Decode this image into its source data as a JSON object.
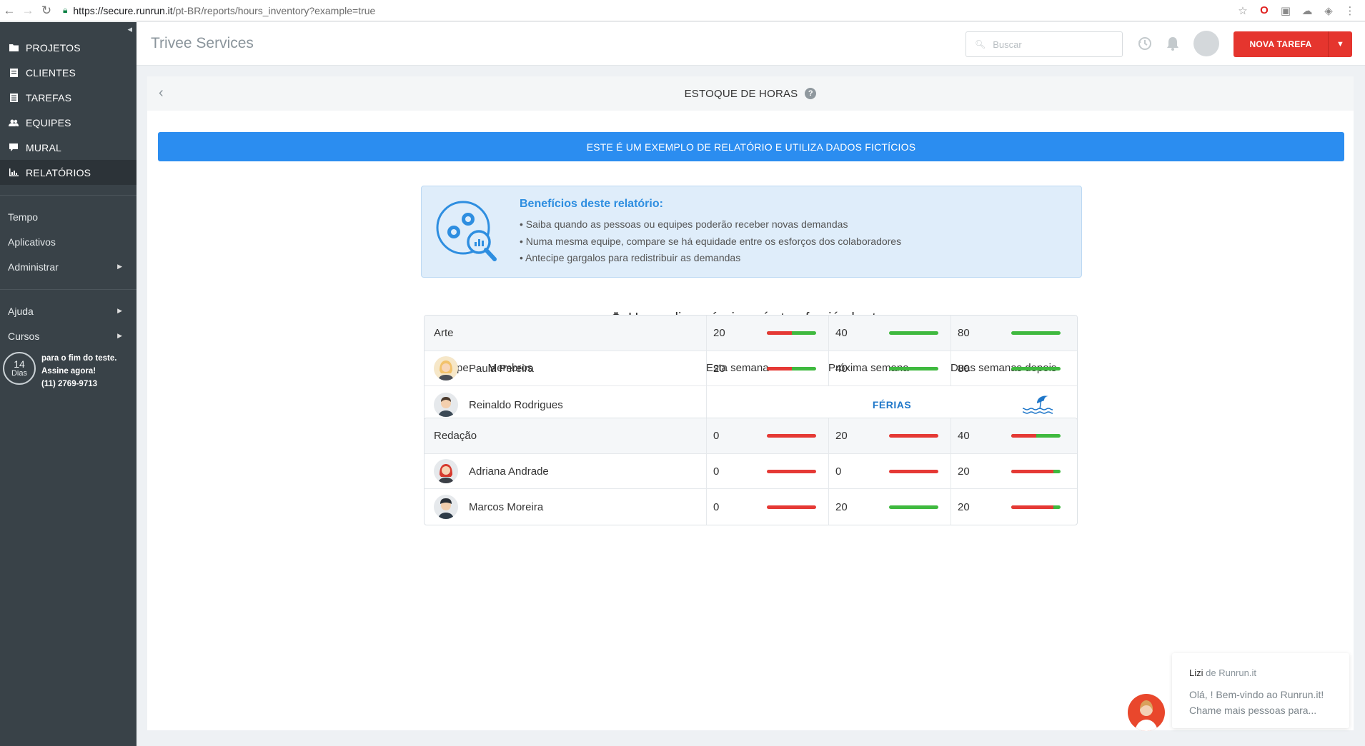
{
  "browser": {
    "url_host": "https://secure.runrun.it",
    "url_path": "/pt-BR/reports/hours_inventory?example=true"
  },
  "sidebar": {
    "nav": [
      {
        "label": "PROJETOS",
        "icon": "folder-icon"
      },
      {
        "label": "CLIENTES",
        "icon": "book-icon"
      },
      {
        "label": "TAREFAS",
        "icon": "list-icon"
      },
      {
        "label": "EQUIPES",
        "icon": "users-icon"
      },
      {
        "label": "MURAL",
        "icon": "chat-bubble-icon"
      },
      {
        "label": "RELATÓRIOS",
        "icon": "bar-chart-icon",
        "active": true
      }
    ],
    "secondary": [
      "Tempo",
      "Aplicativos",
      "Administrar"
    ],
    "help": [
      "Ajuda",
      "Cursos"
    ],
    "trial": {
      "days": "14",
      "days_label": "Dias",
      "line1": "para o fim do teste.",
      "line2": "Assine agora!",
      "line3": "(11) 2769-9713"
    }
  },
  "header": {
    "company": "Trivee Services",
    "search_placeholder": "Buscar",
    "new_task": "NOVA TAREFA"
  },
  "report": {
    "title": "ESTOQUE DE HORAS",
    "sample_banner": "ESTE É UM EXEMPLO DE RELATÓRIO E UTILIZA DADOS FICTÍCIOS",
    "benefits_title": "Benefícios deste relatório:",
    "benefits": [
      "• Saiba quando as pessoas ou equipes poderão receber novas demandas",
      "• Numa mesma equipe, compare se há equidade entre os esforços dos colaboradores",
      "• Antecipe gargalos para redistribuir as demandas"
    ],
    "subtitle": "Horas disponíveis após tarefas já abertas",
    "columns": {
      "team": "Equipe",
      "members": "Membros",
      "this_week": "Esta semana",
      "next_week": "Próxima semana",
      "two_weeks": "Duas semanas depois"
    },
    "vacation_label": "FÉRIAS",
    "colors": {
      "available": "#3fb93f",
      "used": "#e53935",
      "accent": "#2b8df0"
    },
    "teams": [
      {
        "name": "Arte",
        "weeks": [
          {
            "value": "20",
            "used": 0.5
          },
          {
            "value": "40",
            "used": 0
          },
          {
            "value": "80",
            "used": 0
          }
        ],
        "members": [
          {
            "name": "Paula Pereira",
            "weeks": [
              {
                "value": "20",
                "used": 0.5
              },
              {
                "value": "40",
                "used": 0
              },
              {
                "value": "80",
                "used": 0
              }
            ]
          },
          {
            "name": "Reinaldo Rodrigues",
            "vacation": true
          }
        ]
      },
      {
        "name": "Redação",
        "weeks": [
          {
            "value": "0",
            "used": 1
          },
          {
            "value": "20",
            "used": 1
          },
          {
            "value": "40",
            "used": 0.5
          }
        ],
        "members": [
          {
            "name": "Adriana Andrade",
            "weeks": [
              {
                "value": "0",
                "used": 1
              },
              {
                "value": "0",
                "used": 1
              },
              {
                "value": "20",
                "used": 0.85
              }
            ]
          },
          {
            "name": "Marcos Moreira",
            "weeks": [
              {
                "value": "0",
                "used": 1
              },
              {
                "value": "20",
                "used": 0
              },
              {
                "value": "20",
                "used": 0.85
              }
            ]
          }
        ]
      }
    ]
  },
  "chat": {
    "sender": "Lizi",
    "from_suffix": "de Runrun.it",
    "line1": "Olá, ! Bem-vindo ao Runrun.it!",
    "line2": "Chame mais pessoas para..."
  }
}
